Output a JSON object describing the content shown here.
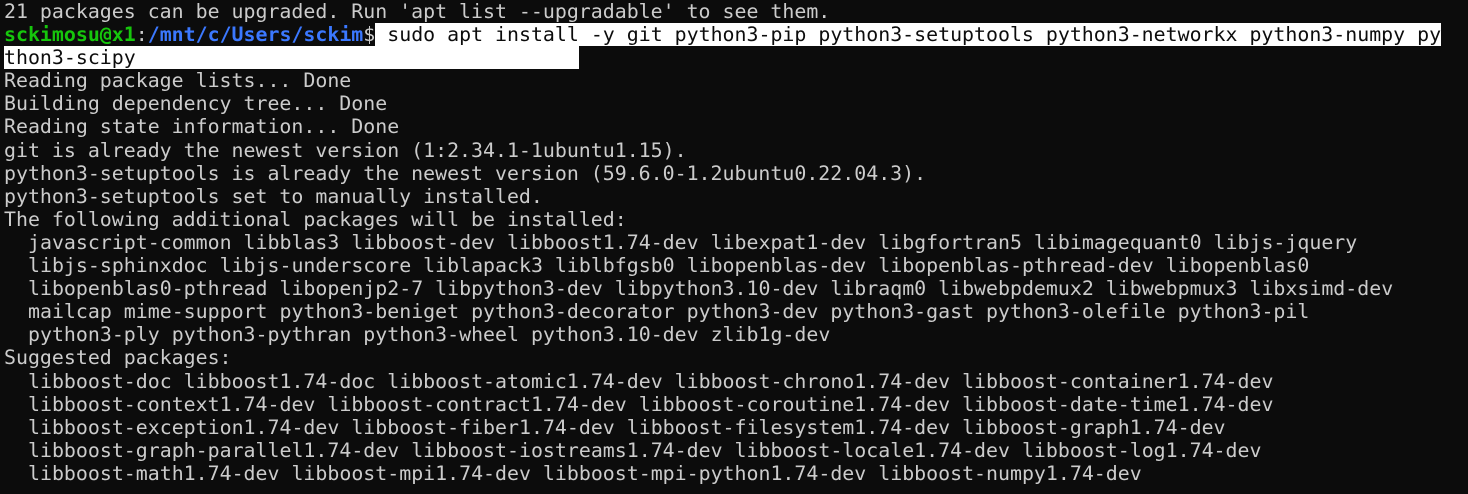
{
  "terminal": {
    "top_line": "21 packages can be upgraded. Run 'apt list --upgradable' to see them.",
    "prompt": {
      "user_host": "sckimosu@x1",
      "separator": ":",
      "path": "/mnt/c/Users/sckim",
      "symbol": "$",
      "command_line1": " sudo apt install -y git python3-pip python3-setuptools python3-networkx python3-numpy py",
      "command_line2": "thon3-scipy                                     "
    },
    "output": [
      "Reading package lists... Done",
      "Building dependency tree... Done",
      "Reading state information... Done",
      "git is already the newest version (1:2.34.1-1ubuntu1.15).",
      "python3-setuptools is already the newest version (59.6.0-1.2ubuntu0.22.04.3).",
      "python3-setuptools set to manually installed.",
      "The following additional packages will be installed:"
    ],
    "additional_packages": [
      "javascript-common libblas3 libboost-dev libboost1.74-dev libexpat1-dev libgfortran5 libimagequant0 libjs-jquery",
      "libjs-sphinxdoc libjs-underscore liblapack3 liblbfgsb0 libopenblas-dev libopenblas-pthread-dev libopenblas0",
      "libopenblas0-pthread libopenjp2-7 libpython3-dev libpython3.10-dev libraqm0 libwebpdemux2 libwebpmux3 libxsimd-dev",
      "mailcap mime-support python3-beniget python3-decorator python3-dev python3-gast python3-olefile python3-pil",
      "python3-ply python3-pythran python3-wheel python3.10-dev zlib1g-dev"
    ],
    "suggested_header": "Suggested packages:",
    "suggested_packages": [
      "libboost-doc libboost1.74-doc libboost-atomic1.74-dev libboost-chrono1.74-dev libboost-container1.74-dev",
      "libboost-context1.74-dev libboost-contract1.74-dev libboost-coroutine1.74-dev libboost-date-time1.74-dev",
      "libboost-exception1.74-dev libboost-fiber1.74-dev libboost-filesystem1.74-dev libboost-graph1.74-dev",
      "libboost-graph-parallel1.74-dev libboost-iostreams1.74-dev libboost-locale1.74-dev libboost-log1.74-dev",
      "libboost-math1.74-dev libboost-mpi1.74-dev libboost-mpi-python1.74-dev libboost-numpy1.74-dev"
    ],
    "colors": {
      "background": "#0c0c0c",
      "foreground": "#cccccc",
      "user_host": "#16c60c",
      "path": "#3b78ff",
      "selection_bg": "#ffffff",
      "selection_fg": "#0c0c0c"
    }
  }
}
